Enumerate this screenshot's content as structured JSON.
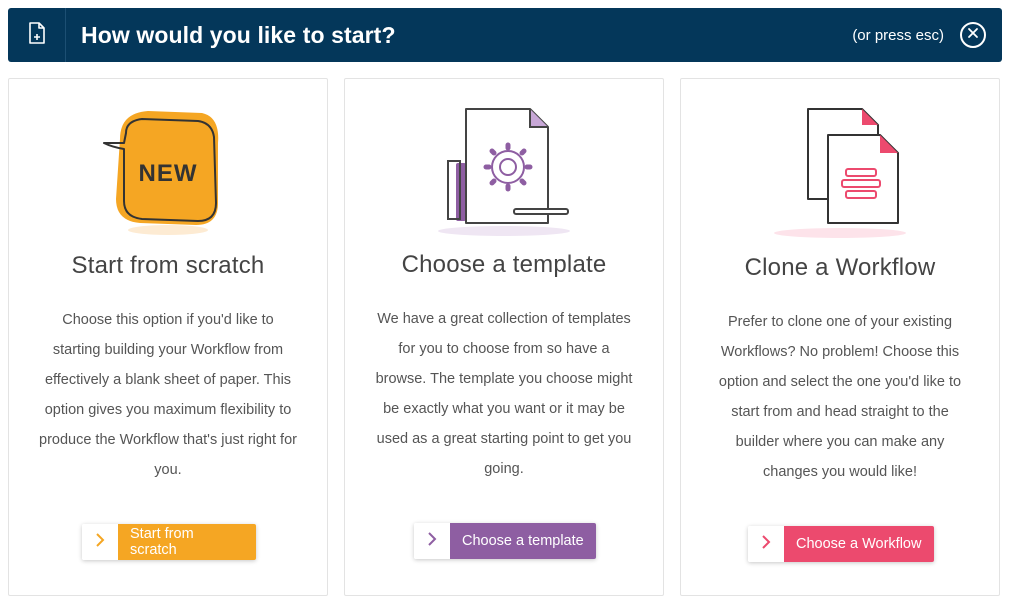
{
  "header": {
    "title": "How would you like to start?",
    "esc_hint": "(or press esc)",
    "icon": "new-document-icon",
    "close_icon": "close-icon"
  },
  "colors": {
    "header_bg": "#04375a",
    "orange": "#f5a623",
    "purple": "#8e5ea2",
    "pink": "#ec4a6e"
  },
  "cards": [
    {
      "illustration": "new-badge-icon",
      "badge_text": "NEW",
      "title": "Start from scratch",
      "description": "Choose this option if you'd like to starting building your Workflow from effectively a blank sheet of paper. This option gives you maximum flexibility to produce the Workflow that's just right for you.",
      "button_label": "Start from scratch"
    },
    {
      "illustration": "template-document-icon",
      "title": "Choose a template",
      "description": "We have a great collection of templates for you to choose from so have a browse. The template you choose might be exactly what you want or it may be used as a great starting point to get you going.",
      "button_label": "Choose a template"
    },
    {
      "illustration": "clone-documents-icon",
      "title": "Clone a Workflow",
      "description": "Prefer to clone one of your existing Workflows? No problem! Choose this option and select the one you'd like to start from and head straight to the builder where you can make any changes you would like!",
      "button_label": "Choose a Workflow"
    }
  ]
}
